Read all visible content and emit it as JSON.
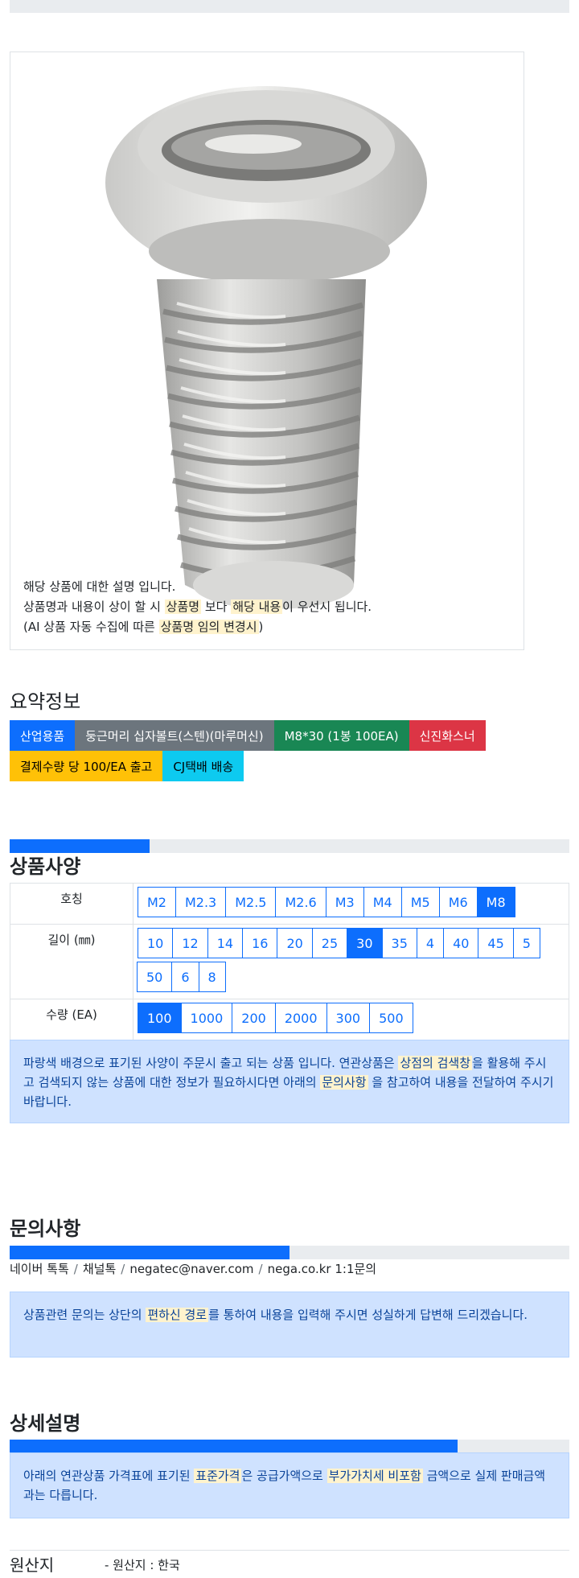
{
  "product": {
    "image_alt": "stainless steel round head cross-recessed machine screw",
    "desc_line1": "해당 상품에 대한 설명 입니다.",
    "desc_line2_a": "상품명과 내용이 상이 할 시 ",
    "desc_line2_hl1": "상품명",
    "desc_line2_b": " 보다 ",
    "desc_line2_hl2": "해당 내용",
    "desc_line2_c": "이 우선시 됩니다.",
    "desc_line3_a": "(AI 상품 자동 수집에 따른 ",
    "desc_line3_hl": "상품명 임의 변경시",
    "desc_line3_b": ")"
  },
  "summary": {
    "title": "요약정보",
    "badges_row1": [
      {
        "label": "산업용품",
        "color": "#0d6efd",
        "text_color": "#ffffff"
      },
      {
        "label": "둥근머리 십자볼트(스텐)(마루머신)",
        "color": "#6c757d",
        "text_color": "#ffffff"
      },
      {
        "label": "M8*30 (1봉 100EA)",
        "color": "#198754",
        "text_color": "#ffffff"
      },
      {
        "label": "신진화스너",
        "color": "#dc3545",
        "text_color": "#ffffff"
      }
    ],
    "badges_row2": [
      {
        "label": "결제수량 당 100/EA 출고",
        "color": "#ffc107",
        "text_color": "#000000"
      },
      {
        "label": "CJ택배 배송",
        "color": "#0dcaf0",
        "text_color": "#000000"
      }
    ]
  },
  "specs": {
    "title": "상품사양",
    "progress": 0.25,
    "rows": [
      {
        "label": "호칭",
        "options": [
          "M2",
          "M2.3",
          "M2.5",
          "M2.6",
          "M3",
          "M4",
          "M5",
          "M6",
          "M8"
        ],
        "selected": "M8"
      },
      {
        "label": "길이 (㎜)",
        "options": [
          "10",
          "12",
          "14",
          "16",
          "20",
          "25",
          "30",
          "35",
          "4",
          "40",
          "45",
          "5",
          "50",
          "6",
          "8"
        ],
        "selected": "30"
      },
      {
        "label": "수량 (EA)",
        "options": [
          "100",
          "1000",
          "200",
          "2000",
          "300",
          "500"
        ],
        "selected": "100"
      }
    ],
    "notice_a": "파랑색 배경으로 표기된 사양이 주문시 출고 되는 상품 입니다. 연관상품은 ",
    "notice_hl1": "상점의 검색창",
    "notice_b": "을 활용해 주시고 검색되지 않는 상품에 대한 정보가 필요하시다면 아래의 ",
    "notice_hl2": "문의사항",
    "notice_c": " 을 참고하여 내용을 전달하여 주시기 바랍니다."
  },
  "inquiry": {
    "title": "문의사항",
    "progress": 0.5,
    "channels": [
      "네이버 톡톡",
      "채널톡",
      "negatec@naver.com",
      "nega.co.kr 1:1문의"
    ],
    "notice_a": "상품관련 문의는 상단의 ",
    "notice_hl": "편하신 경로",
    "notice_b": "를 통하여 내용을 입력해 주시면 성실하게 답변해 드리겠습니다."
  },
  "detail": {
    "title": "상세설명",
    "progress": 0.8,
    "notice_a": "아래의 연관상품 가격표에 표기된 ",
    "notice_hl1": "표준가격",
    "notice_b": "은 공급가액으로 ",
    "notice_hl2": "부가가치세 비포함",
    "notice_c": " 금액으로 실제 판매금액과는 다릅니다."
  },
  "origin": {
    "label": "원산지",
    "value": "- 원산지 : 한국"
  }
}
